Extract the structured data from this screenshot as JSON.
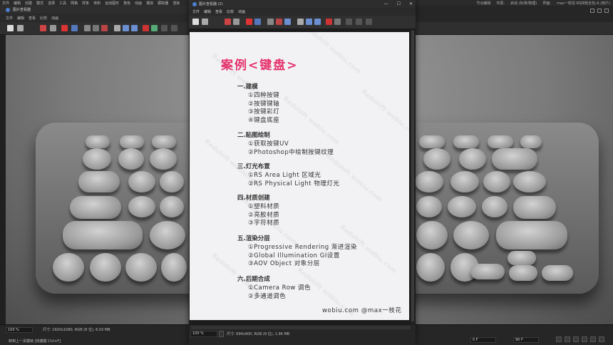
{
  "top_menu": [
    "文件",
    "编辑",
    "创建",
    "模式",
    "选择",
    "工具",
    "网格",
    "样条",
    "体积",
    "运动图形",
    "角色",
    "动画",
    "模拟",
    "跟踪器",
    "渲染"
  ],
  "top_right": [
    "节点编辑",
    "布局:",
    "启动 (标准/物理)",
    "界面:",
    "max一枝花-RS四枝全包-A (用户)"
  ],
  "bg_window": {
    "title": "图片查看器",
    "menu": [
      "文件",
      "编辑",
      "查看",
      "比较",
      "动画"
    ],
    "zoom": "100 %",
    "size_info": "尺寸: 1920x1080, RGB (8 位), 6.03 MB",
    "hint": "转到上一关键帧 [快捷键 Ctrl+F]",
    "frame_start": "0 F",
    "frame_end": "90 F"
  },
  "viewer": {
    "title": "图片查看器 (2)",
    "menu": [
      "文件",
      "编辑",
      "查看",
      "比较",
      "动画"
    ],
    "zoom": "100 %",
    "size_info": "尺寸: 694x900, RGB (8 位), 1.96 MB",
    "controls": {
      "minimize": "—",
      "maximize": "☐",
      "close": "✕"
    }
  },
  "document": {
    "title": "案例<键盘>",
    "watermark": "Redshift   wobiu.com",
    "sections": [
      {
        "heading": "一.建模",
        "items": [
          "①四种按键",
          "②按键键轴",
          "③按键彩灯",
          "④键盘底座"
        ]
      },
      {
        "heading": "二.贴图绘制",
        "items": [
          "①获取按键UV",
          "②Photoshop中绘制按键纹理"
        ]
      },
      {
        "heading": "三.灯光布置",
        "items": [
          "①RS Area Light 区域光",
          "②RS Physical Light 物理灯光"
        ]
      },
      {
        "heading": "四.材质创建",
        "items": [
          "①塑料材质",
          "②亮胶材质",
          "③字符材质"
        ]
      },
      {
        "heading": "五.渲染分层",
        "items": [
          "①Progressive Rendering 渐进渲染",
          "②Global Illumination GI设置",
          "③AOV Object 对象分层"
        ]
      },
      {
        "heading": "六.后期合成",
        "items": [
          "①Camera Row 调色",
          "②多通道调色"
        ]
      }
    ],
    "footer": "wobiu.com  @max一枝花"
  },
  "colors": {
    "title_accent": "#e6336d",
    "doc_bg": "#f2f2f4",
    "ui_bg": "#262626"
  }
}
